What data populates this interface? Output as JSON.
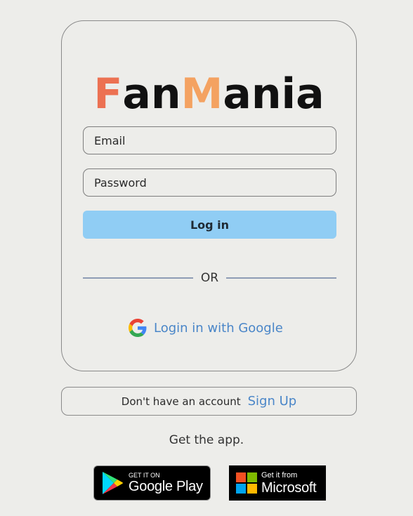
{
  "logo": {
    "parts": [
      {
        "text": "F",
        "color": "#ec7152"
      },
      {
        "text": "an",
        "color": "#111111"
      },
      {
        "text": "M",
        "color": "#f4a261"
      },
      {
        "text": "ania",
        "color": "#111111"
      }
    ]
  },
  "form": {
    "email_placeholder": "Email",
    "password_placeholder": "Password",
    "login_label": "Log in"
  },
  "divider": {
    "text": "OR"
  },
  "google": {
    "label": "Login in with Google",
    "icon": "google-g-icon"
  },
  "signup": {
    "prompt": "Don't have an account",
    "link": "Sign Up"
  },
  "get_app": "Get the app.",
  "stores": {
    "google_play": {
      "small": "GET IT ON",
      "big": "Google Play",
      "icon": "google-play-icon"
    },
    "microsoft": {
      "small": "Get it from",
      "big": "Microsoft",
      "icon": "microsoft-logo-icon"
    }
  },
  "colors": {
    "background": "#ededea",
    "button": "#90cdf4",
    "link": "#4a86c8"
  }
}
